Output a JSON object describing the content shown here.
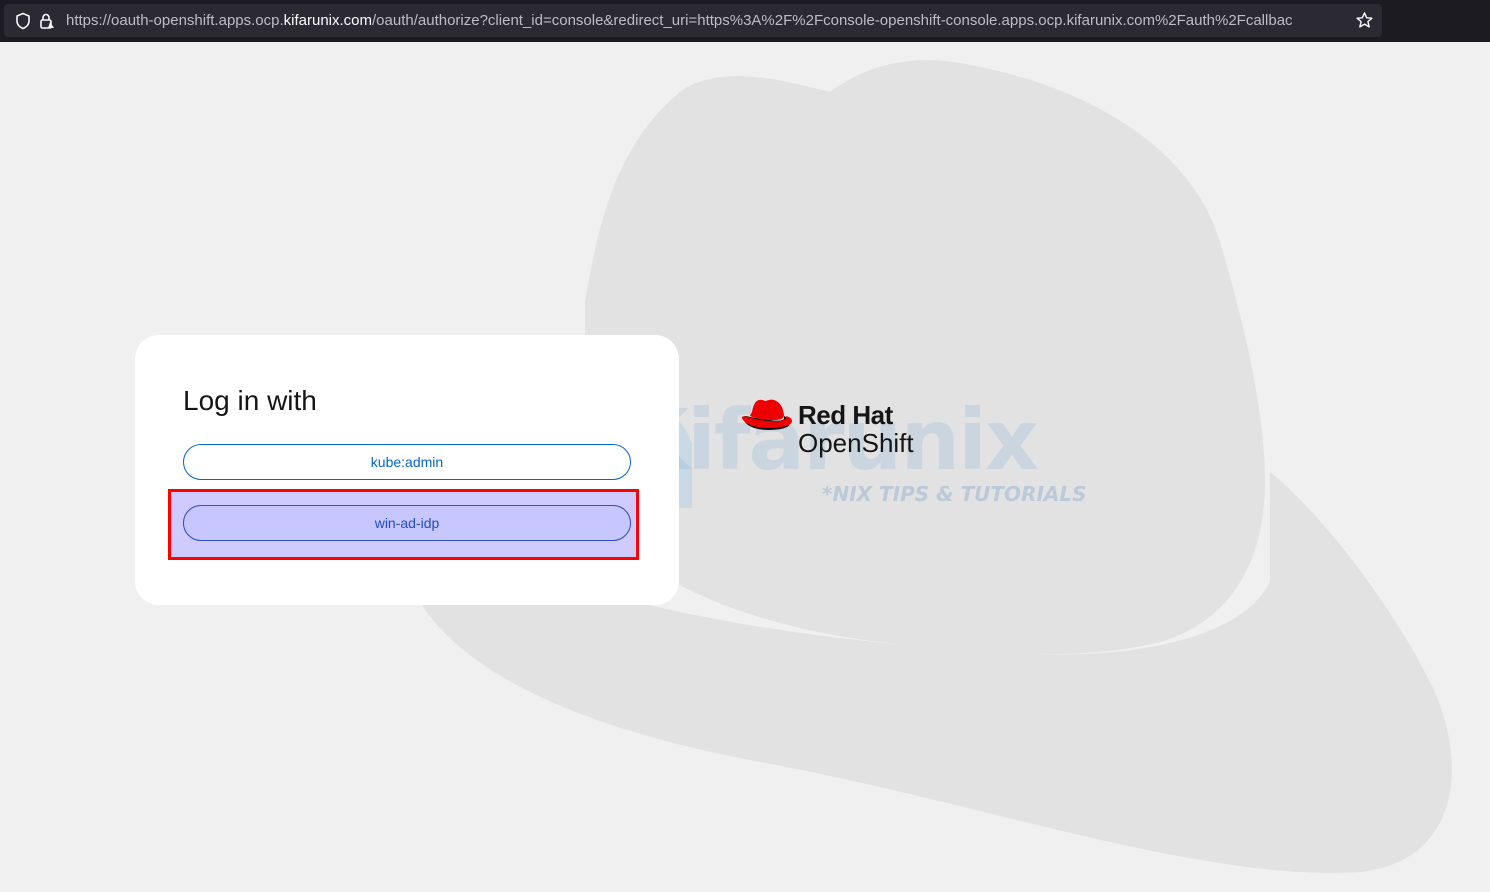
{
  "browser": {
    "url_prefix": "https://oauth-openshift.apps.ocp.",
    "url_domain": "kifarunix.com",
    "url_suffix": "/oauth/authorize?client_id=console&redirect_uri=https%3A%2F%2Fconsole-openshift-console.apps.ocp.kifarunix.com%2Fauth%2Fcallbac",
    "icons": [
      "shield-icon",
      "lock-icon",
      "bookmark-star-icon"
    ]
  },
  "login": {
    "title": "Log in with",
    "providers": [
      {
        "label": "kube:admin"
      },
      {
        "label": "win-ad-idp"
      }
    ]
  },
  "brand": {
    "line1": "Red Hat",
    "line2": "OpenShift",
    "icon": "red-hat-logo-icon"
  },
  "watermark": {
    "name": "Kifarunix",
    "tagline": "*NIX TIPS & TUTORIALS"
  },
  "colors": {
    "accent": "#0066cc",
    "highlight": "#ff0000",
    "brand_red": "#ee0000"
  }
}
